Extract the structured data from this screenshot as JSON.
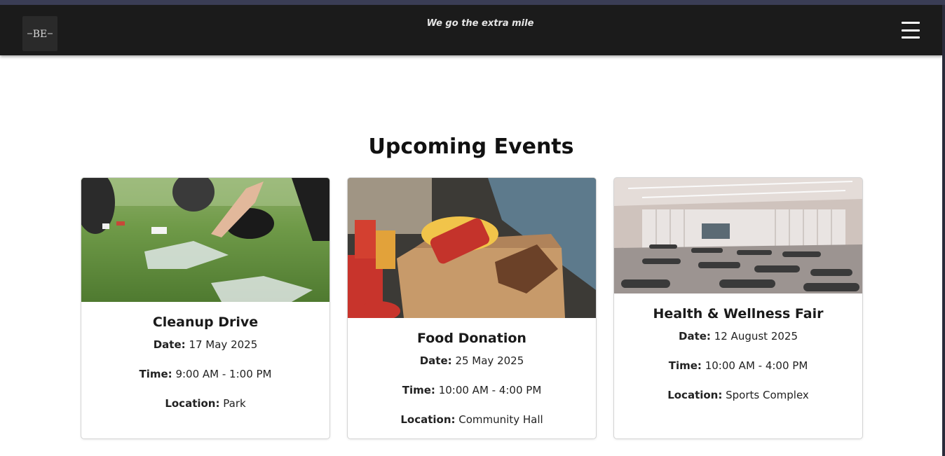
{
  "navbar": {
    "logo_text": "BE",
    "tagline": "We go the extra mile"
  },
  "events_section": {
    "title": "Upcoming Events"
  },
  "events": [
    {
      "title": "Cleanup Drive",
      "date_label": "Date:",
      "date": "17 May 2025",
      "time_label": "Time:",
      "time": "9:00 AM - 1:00 PM",
      "location_label": "Location:",
      "location": "Park"
    },
    {
      "title": "Food Donation",
      "date_label": "Date:",
      "date": "25 May 2025",
      "time_label": "Time:",
      "time": "10:00 AM - 4:00 PM",
      "location_label": "Location:",
      "location": "Community Hall"
    },
    {
      "title": "Health & Wellness Fair",
      "date_label": "Date:",
      "date": "12 August 2025",
      "time_label": "Time:",
      "time": "10:00 AM - 4:00 PM",
      "location_label": "Location:",
      "location": "Sports Complex"
    }
  ],
  "colors": {
    "navbar_bg": "#1b1b1b",
    "page_bg": "#ffffff",
    "title_text": "#111111"
  }
}
